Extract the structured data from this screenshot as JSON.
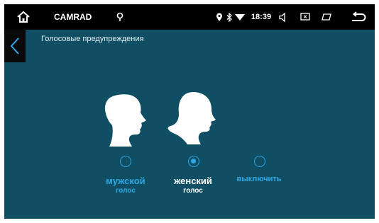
{
  "status_bar": {
    "app_name": "CAMRAD",
    "time": "18:39",
    "icons": [
      "home-icon",
      "gps-icon",
      "location-icon",
      "bluetooth-icon",
      "wifi-icon",
      "volume-icon",
      "screen-icon",
      "window-icon",
      "return-icon"
    ]
  },
  "header": {
    "title": "Голосовые предупреждения"
  },
  "options": [
    {
      "main": "мужской",
      "sub": "голос",
      "selected": false
    },
    {
      "main": "женский",
      "sub": "голос",
      "selected": true
    },
    {
      "main": "выключить",
      "sub": "",
      "selected": false
    }
  ],
  "colors": {
    "background": "#0f4e63",
    "accent": "#2fa8e6",
    "statusbar": "#000000"
  }
}
